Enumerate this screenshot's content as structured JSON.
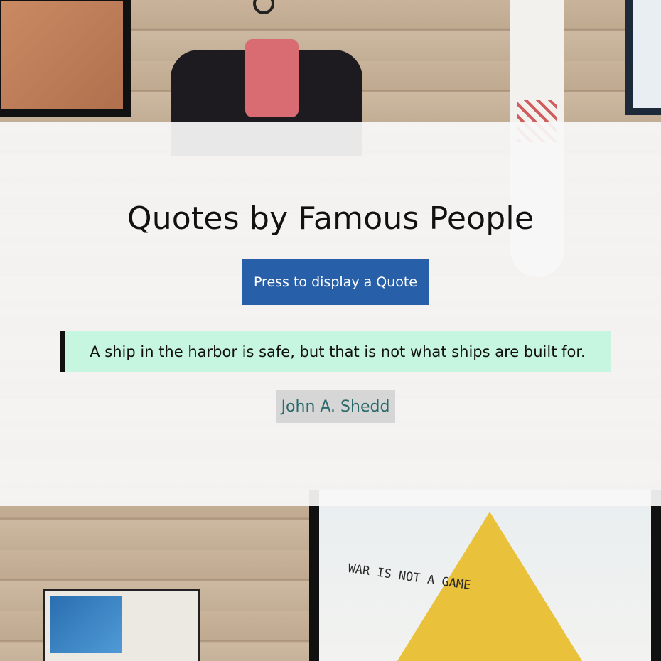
{
  "page": {
    "title": "Quotes by Famous People"
  },
  "controls": {
    "display_button_label": "Press to display a Quote"
  },
  "quote": {
    "text": "A ship in the harbor is safe, but that is not what ships are built for.",
    "author": "John A. Shedd"
  },
  "background": {
    "poster_text": "WAR IS NOT A GAME"
  },
  "colors": {
    "button_bg": "#2760a9",
    "quote_bg": "#c6f6e0",
    "author_bg": "#d6d6d6",
    "author_text": "#2b6a6a"
  }
}
